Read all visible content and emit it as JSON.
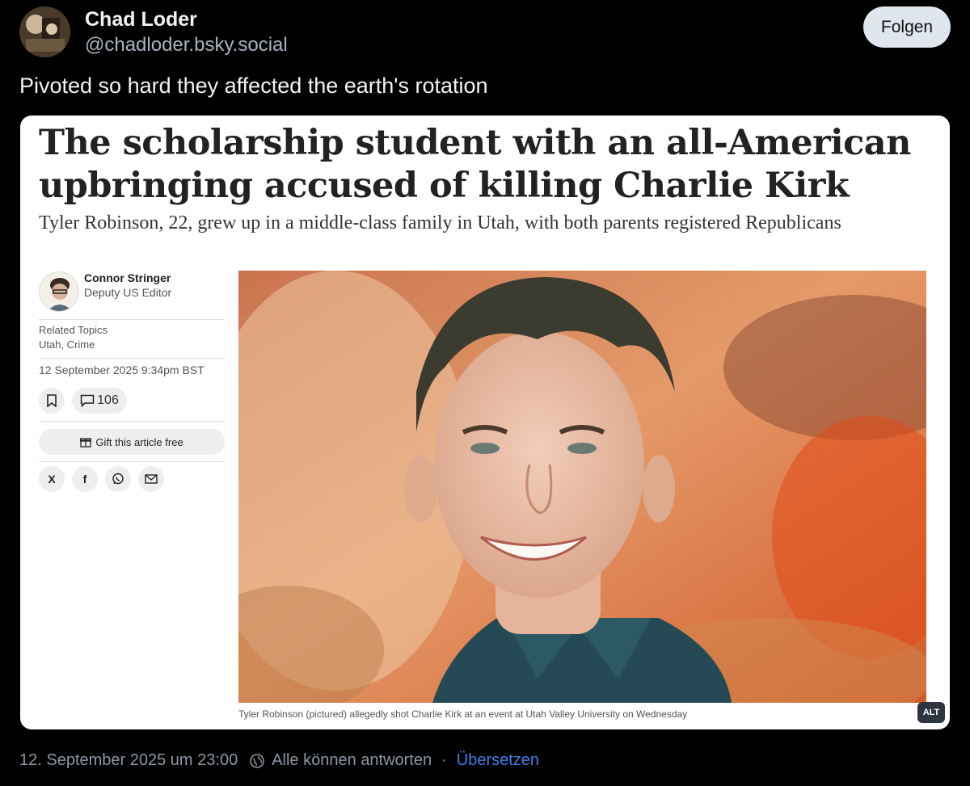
{
  "post": {
    "author_name": "Chad Loder",
    "author_handle": "@chadloder.bsky.social",
    "follow_label": "Folgen",
    "text": "Pivoted so hard they affected the earth's rotation",
    "timestamp": "12. September 2025 um 23:00",
    "reply_setting": "Alle können antworten",
    "separator": "·",
    "translate_label": "Übersetzen",
    "alt_badge": "ALT"
  },
  "article": {
    "headline_line1": "The scholarship student with an all-American",
    "headline_line2": "upbringing accused of killing Charlie Kirk",
    "standfirst": "Tyler Robinson, 22, grew up in a middle-class family in Utah, with both parents registered Republicans",
    "author": "Connor Stringer",
    "author_role": "Deputy US Editor",
    "topics_label": "Related Topics",
    "topics": "Utah, Crime",
    "date": "12 September 2025 9:34pm BST",
    "comment_count": "106",
    "gift_label": "Gift this article free",
    "share_x": "X",
    "share_facebook": "f",
    "caption": "Tyler Robinson (pictured) allegedly shot Charlie Kirk at an event at Utah Valley University on Wednesday"
  },
  "colors": {
    "background": "#000000",
    "accent_link": "#3f7ee8",
    "follow_button": "#dfe6ee"
  },
  "icons": [
    "avatar-image",
    "bookmark-icon",
    "comment-icon",
    "gift-icon",
    "x-icon",
    "facebook-icon",
    "whatsapp-icon",
    "email-icon",
    "globe-reply-icon"
  ]
}
